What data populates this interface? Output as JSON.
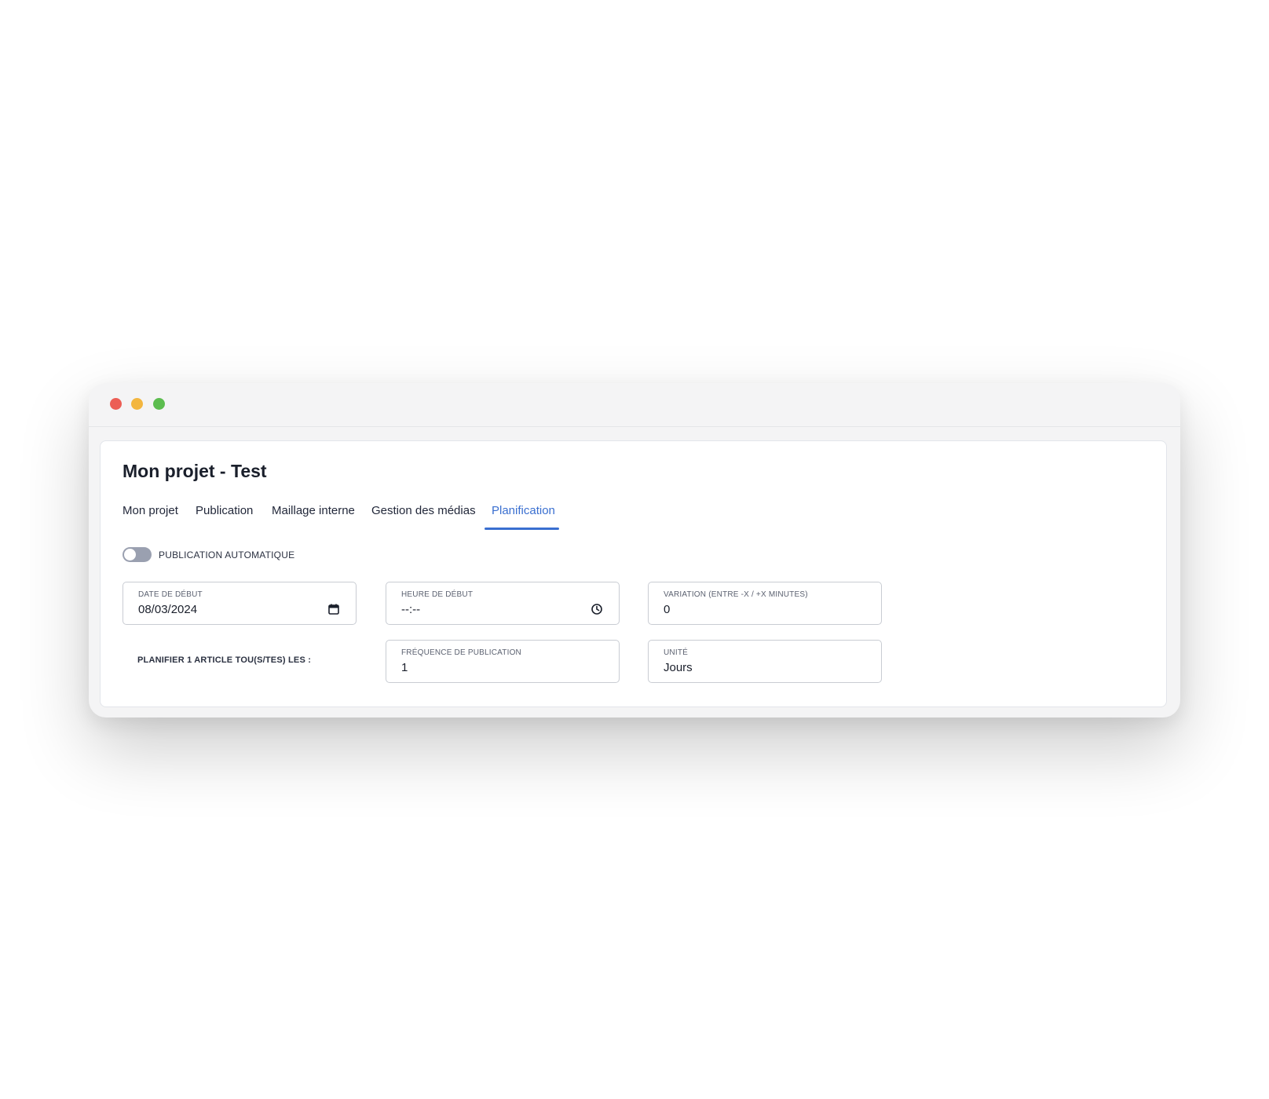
{
  "window": {
    "controls": [
      {
        "name": "close",
        "color": "#ec5e55"
      },
      {
        "name": "minimize",
        "color": "#f3b63f"
      },
      {
        "name": "maximize",
        "color": "#5cbd4f"
      }
    ]
  },
  "page": {
    "title": "Mon projet - Test"
  },
  "tabs": [
    {
      "label": "Mon projet",
      "active": false
    },
    {
      "label": "Publication",
      "active": false
    },
    {
      "label": "Maillage interne",
      "active": false
    },
    {
      "label": "Gestion des médias",
      "active": false
    },
    {
      "label": "Planification",
      "active": true
    }
  ],
  "auto_publish": {
    "label": "PUBLICATION AUTOMATIQUE",
    "enabled": false
  },
  "fields": {
    "start_date": {
      "label": "DATE DE DÉBUT",
      "value": "08/03/2024",
      "icon": "calendar-icon"
    },
    "start_time": {
      "label": "HEURE DE DÉBUT",
      "value": "--:--",
      "icon": "clock-icon"
    },
    "variation": {
      "label": "VARIATION (ENTRE -X / +X MINUTES)",
      "value": "0"
    },
    "frequency": {
      "label": "FRÉQUENCE DE PUBLICATION",
      "value": "1"
    },
    "unit": {
      "label": "UNITÉ",
      "value": "Jours"
    }
  },
  "schedule_label": "PLANIFIER 1 ARTICLE TOU(S/TES) LES :",
  "colors": {
    "accent": "#3a6fd0",
    "toggle_off": "#9aa0b0"
  }
}
